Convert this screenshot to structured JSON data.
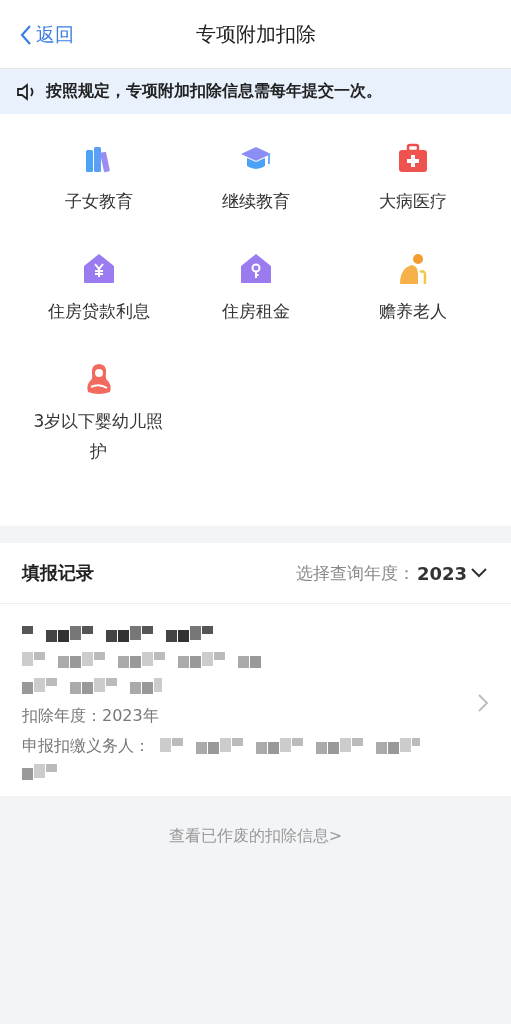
{
  "nav": {
    "back": "返回",
    "title": "专项附加扣除"
  },
  "notice": "按照规定，专项附加扣除信息需每年提交一次。",
  "categories": [
    {
      "label": "子女教育",
      "kind": "books"
    },
    {
      "label": "继续教育",
      "kind": "cap"
    },
    {
      "label": "大病医疗",
      "kind": "medkit"
    },
    {
      "label": "住房贷款利息",
      "kind": "houseyen"
    },
    {
      "label": "住房租金",
      "kind": "housekey"
    },
    {
      "label": "赡养老人",
      "kind": "elder"
    },
    {
      "label": "3岁以下婴幼儿照护",
      "kind": "mother"
    }
  ],
  "records": {
    "title": "填报记录",
    "year_label": "选择查询年度：",
    "year": "2023",
    "items": [
      {
        "lines": [
          {
            "kind": "redacted"
          },
          {
            "kind": "redacted"
          },
          {
            "kind": "redacted"
          },
          {
            "kind": "text",
            "text": "扣除年度：2023年"
          },
          {
            "kind": "labeled",
            "label": "申报扣缴义务人："
          }
        ]
      }
    ]
  },
  "footer_link": "查看已作废的扣除信息>"
}
